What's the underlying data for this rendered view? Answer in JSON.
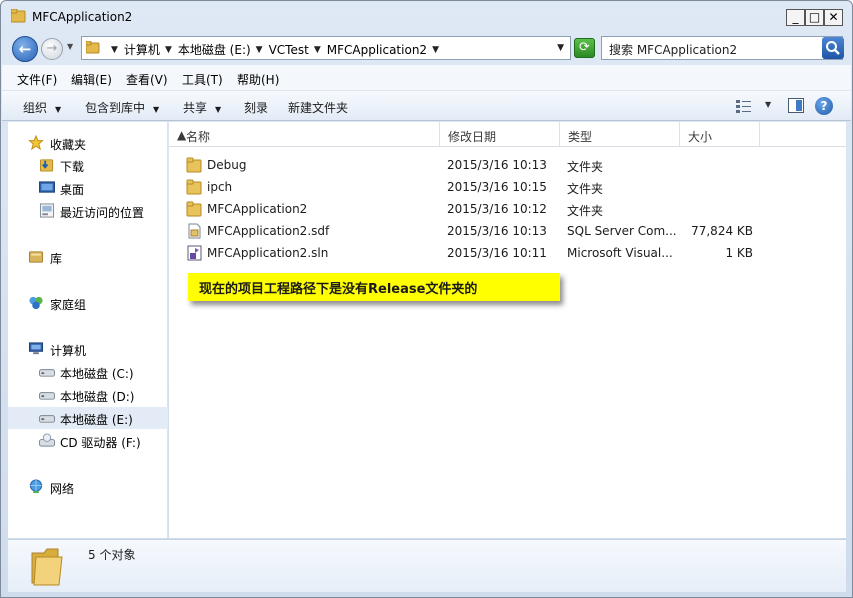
{
  "window": {
    "title": "MFCApplication2",
    "caption_minimize": "_",
    "caption_maximize": "□",
    "caption_close": "✕"
  },
  "address": {
    "crumbs": [
      "计算机",
      "本地磁盘 (E:)",
      "VCTest",
      "MFCApplication2"
    ],
    "search_placeholder": "搜索 MFCApplication2"
  },
  "menu": [
    "文件(F)",
    "编辑(E)",
    "查看(V)",
    "工具(T)",
    "帮助(H)"
  ],
  "toolbar": {
    "organize": "组织",
    "include_in_library": "包含到库中",
    "share": "共享",
    "burn": "刻录",
    "new_folder": "新建文件夹"
  },
  "nav": {
    "favorites": "收藏夹",
    "favorites_items": [
      "下载",
      "桌面",
      "最近访问的位置"
    ],
    "libraries": "库",
    "homegroup": "家庭组",
    "computer": "计算机",
    "drives": [
      "本地磁盘 (C:)",
      "本地磁盘 (D:)",
      "本地磁盘 (E:)",
      "CD 驱动器 (F:)"
    ],
    "network": "网络",
    "selected": "本地磁盘 (E:)"
  },
  "columns": {
    "name": "名称",
    "date": "修改日期",
    "type": "类型",
    "size": "大小"
  },
  "files": [
    {
      "name": "Debug",
      "date": "2015/3/16 10:13",
      "type": "文件夹",
      "size": "",
      "icon": "folder-icon"
    },
    {
      "name": "ipch",
      "date": "2015/3/16 10:15",
      "type": "文件夹",
      "size": "",
      "icon": "folder-icon"
    },
    {
      "name": "MFCApplication2",
      "date": "2015/3/16 10:12",
      "type": "文件夹",
      "size": "",
      "icon": "folder-icon"
    },
    {
      "name": "MFCApplication2.sdf",
      "date": "2015/3/16 10:13",
      "type": "SQL Server Com...",
      "size": "77,824 KB",
      "icon": "sdf-file-icon"
    },
    {
      "name": "MFCApplication2.sln",
      "date": "2015/3/16 10:11",
      "type": "Microsoft Visual...",
      "size": "1 KB",
      "icon": "sln-file-icon"
    }
  ],
  "annotation": "现在的项目工程路径下是没有Release文件夹的",
  "status": {
    "count": "5 个对象"
  },
  "colors": {
    "callout": "#ffff00",
    "folder": "#e8c25a",
    "selected_nav": "#e3ecf6"
  }
}
